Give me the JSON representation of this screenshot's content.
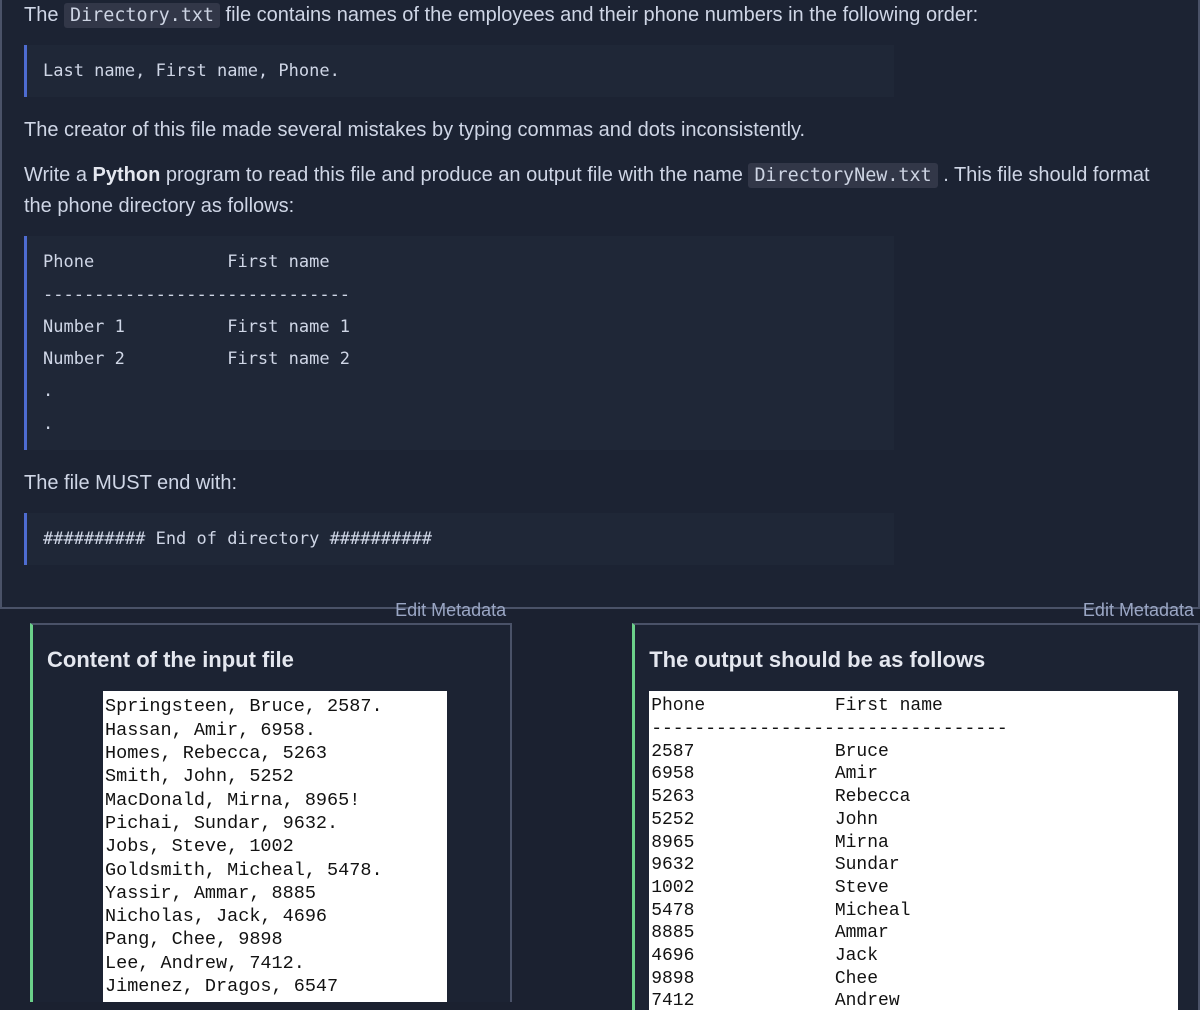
{
  "question": {
    "intro_before_code": "The ",
    "intro_code": "Directory.txt",
    "intro_after_code": " file contains names of the employees and their phone numbers in the following order:",
    "format_block": "Last name, First name, Phone.",
    "mistakes": "The creator of this file made several mistakes by typing commas and dots inconsistently.",
    "write_before_py": "Write a ",
    "python_kw": "Python",
    "write_after_py": " program to read this file and produce an output file with the name ",
    "out_code": "DirectoryNew.txt",
    "write_tail": ". This file should format the phone directory as follows:",
    "output_block": "Phone             First name\n------------------------------\nNumber 1          First name 1\nNumber 2          First name 2\n.\n.",
    "must_end": "The file MUST end with:",
    "end_block": "########## End of directory ##########"
  },
  "left_panel": {
    "edit": "Edit Metadata",
    "title": "Content of the input file",
    "content": "Springsteen, Bruce, 2587.\nHassan, Amir, 6958.\nHomes, Rebecca, 5263\nSmith, John, 5252\nMacDonald, Mirna, 8965!\nPichai, Sundar, 9632.\nJobs, Steve, 1002\nGoldsmith, Micheal, 5478.\nYassir, Ammar, 8885\nNicholas, Jack, 4696\nPang, Chee, 9898\nLee, Andrew, 7412.\nJimenez, Dragos, 6547"
  },
  "right_panel": {
    "edit": "Edit Metadata",
    "title": "The output should be as follows",
    "content": "Phone            First name\n---------------------------------\n2587             Bruce\n6958             Amir\n5263             Rebecca\n5252             John\n8965             Mirna\n9632             Sundar\n1002             Steve\n5478             Micheal\n8885             Ammar\n4696             Jack\n9898             Chee\n7412             Andrew"
  }
}
